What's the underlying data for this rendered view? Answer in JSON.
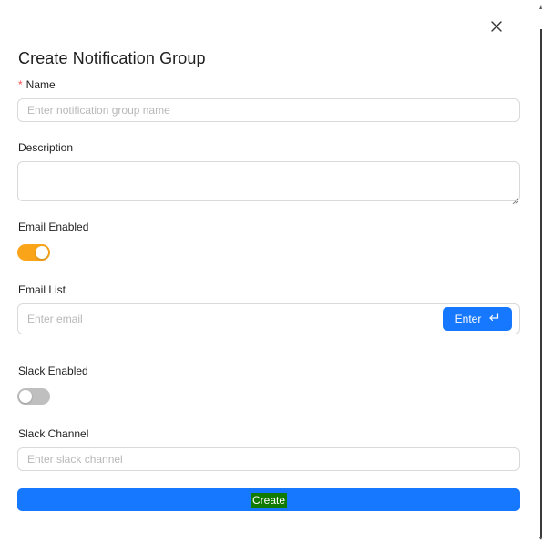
{
  "modal": {
    "title": "Create Notification Group"
  },
  "form": {
    "name": {
      "required_mark": "*",
      "label": "Name",
      "placeholder": "Enter notification group name",
      "value": ""
    },
    "description": {
      "label": "Description",
      "value": ""
    },
    "email_enabled": {
      "label": "Email Enabled",
      "on": true
    },
    "email_list": {
      "label": "Email List",
      "placeholder": "Enter email",
      "value": "",
      "enter_label": "Enter"
    },
    "slack_enabled": {
      "label": "Slack Enabled",
      "on": false
    },
    "slack_channel": {
      "label": "Slack Channel",
      "placeholder": "Enter slack channel",
      "value": ""
    },
    "create_label": "Create"
  },
  "icons": {
    "close": "close-icon",
    "enter": "enter-return-icon"
  },
  "colors": {
    "primary": "#1677ff",
    "toggle_on": "#faa519",
    "toggle_off": "#bfbfbf",
    "required": "#ff4d4f",
    "create_label_bg": "#117a00"
  }
}
